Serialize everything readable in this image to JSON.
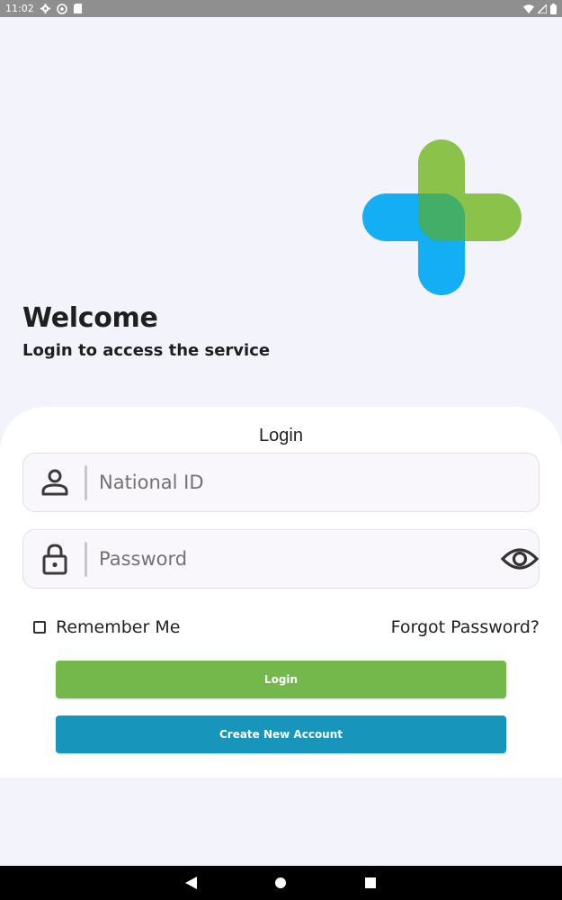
{
  "status_bar": {
    "time": "11:02",
    "left_icons": [
      "gear-icon",
      "sync-icon",
      "sd-card-icon"
    ],
    "right_icons": [
      "wifi-icon",
      "signal-icon",
      "battery-icon"
    ]
  },
  "logo": {
    "name": "medical-cross-logo",
    "colors": [
      "#8bc34a",
      "#03a9f4",
      "#4caf50"
    ]
  },
  "welcome": {
    "title": "Welcome",
    "subtitle": "Login to access the service"
  },
  "login_card": {
    "title": "Login",
    "national_id": {
      "placeholder": "National ID",
      "value": "",
      "icon": "person-icon"
    },
    "password": {
      "placeholder": "Password",
      "value": "",
      "icon": "lock-icon",
      "toggle_icon": "eye-icon"
    },
    "remember_me": {
      "label": "Remember Me",
      "checked": false
    },
    "forgot_password_label": "Forgot Password?",
    "login_button_label": "Login",
    "create_account_button_label": "Create New Account"
  },
  "nav_bar": {
    "buttons": [
      "back-icon",
      "home-icon",
      "recents-icon"
    ]
  },
  "colors": {
    "accent_green": "#74b84b",
    "accent_blue": "#1795bb",
    "background": "#f3f4fb"
  }
}
